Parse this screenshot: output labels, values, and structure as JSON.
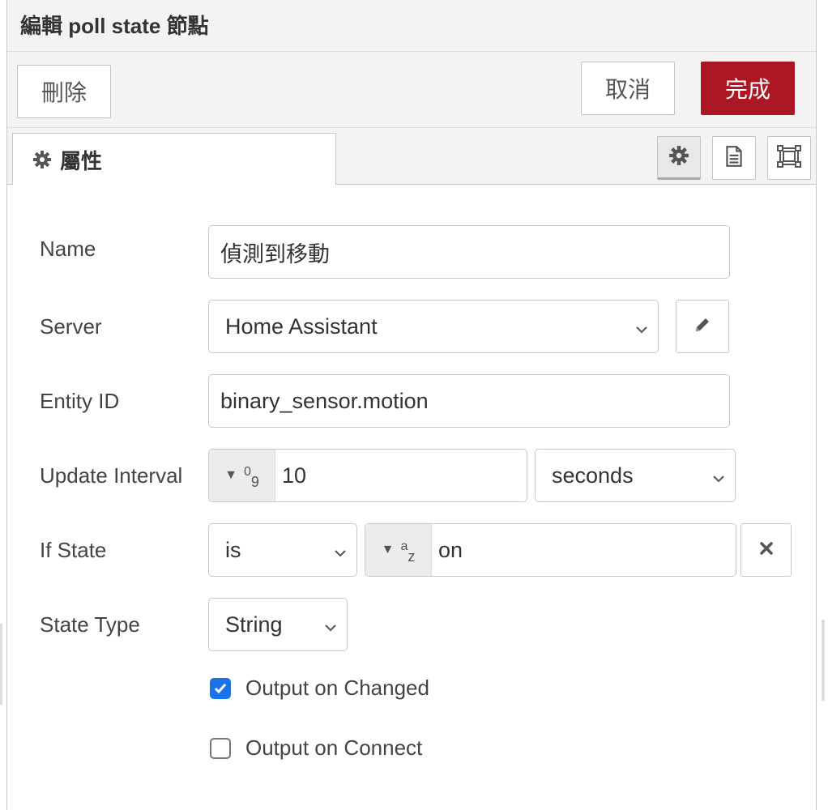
{
  "dialog": {
    "title": "編輯 poll state 節點"
  },
  "toolbar": {
    "delete_label": "刪除",
    "cancel_label": "取消",
    "done_label": "完成"
  },
  "tabs": [
    {
      "label": "屬性",
      "icon": "gear-icon"
    }
  ],
  "tab_icons": [
    "gear-icon",
    "document-icon",
    "frame-icon"
  ],
  "form": {
    "name": {
      "label": "Name",
      "value": "偵測到移動"
    },
    "server": {
      "label": "Server",
      "value": "Home Assistant"
    },
    "entity_id": {
      "label": "Entity ID",
      "value": "binary_sensor.motion"
    },
    "update_interval": {
      "label": "Update Interval",
      "type_sup": "0",
      "type_sub": "9",
      "value": "10",
      "unit": "seconds"
    },
    "if_state": {
      "label": "If State",
      "operator": "is",
      "type_sup": "a",
      "type_sub": "z",
      "value": "on"
    },
    "state_type": {
      "label": "State Type",
      "value": "String"
    },
    "output_on_changed": {
      "label": "Output on Changed",
      "checked": true
    },
    "output_on_connect": {
      "label": "Output on Connect",
      "checked": false
    }
  },
  "colors": {
    "primary": "#ad1625",
    "checkbox": "#1a73e8"
  }
}
